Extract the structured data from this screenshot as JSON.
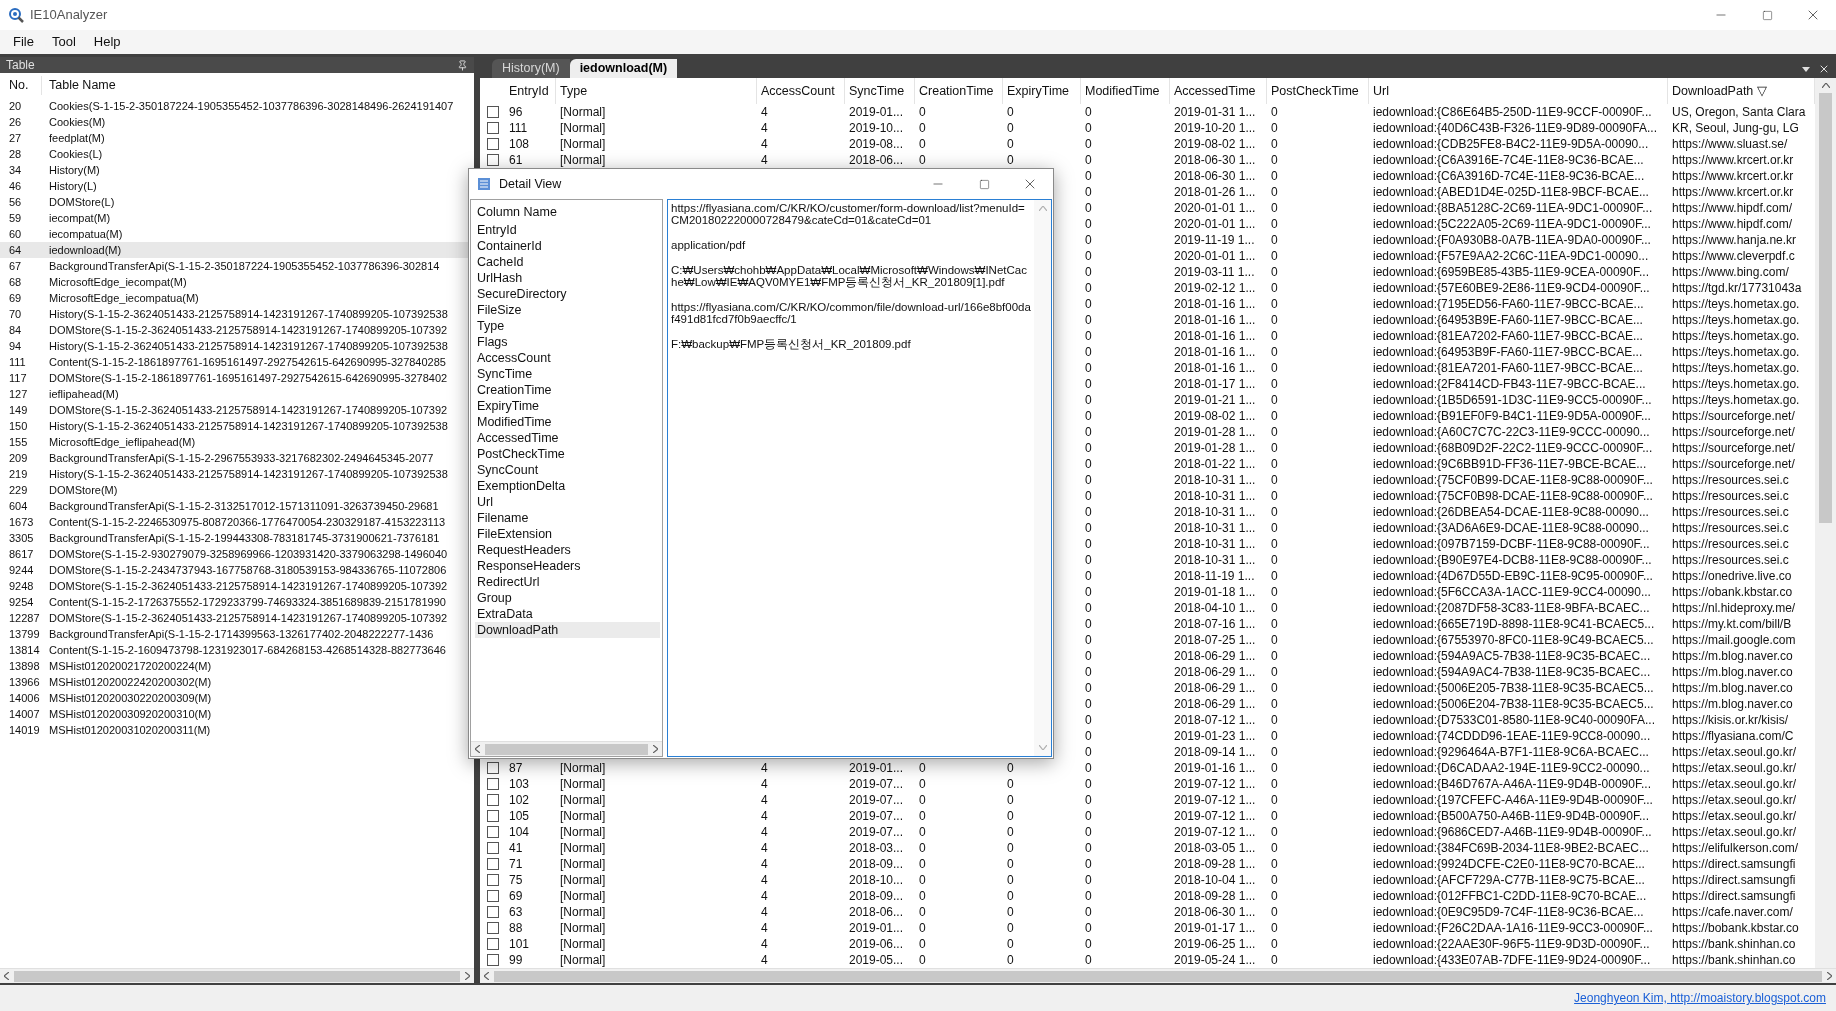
{
  "window": {
    "title": "IE10Analyzer"
  },
  "menu": [
    "File",
    "Tool",
    "Help"
  ],
  "table_panel": {
    "title": "Table",
    "columns": [
      "No.",
      "Table Name"
    ],
    "rows": [
      {
        "no": "20",
        "name": "Cookies(S-1-15-2-350187224-1905355452-1037786396-3028148496-2624191407",
        "selected": false
      },
      {
        "no": "26",
        "name": "Cookies(M)",
        "selected": false
      },
      {
        "no": "27",
        "name": "feedplat(M)",
        "selected": false
      },
      {
        "no": "28",
        "name": "Cookies(L)",
        "selected": false
      },
      {
        "no": "34",
        "name": "History(M)",
        "selected": false
      },
      {
        "no": "46",
        "name": "History(L)",
        "selected": false
      },
      {
        "no": "56",
        "name": "DOMStore(L)",
        "selected": false
      },
      {
        "no": "59",
        "name": "iecompat(M)",
        "selected": false
      },
      {
        "no": "60",
        "name": "iecompatua(M)",
        "selected": false
      },
      {
        "no": "64",
        "name": "iedownload(M)",
        "selected": true
      },
      {
        "no": "67",
        "name": "BackgroundTransferApi(S-1-15-2-350187224-1905355452-1037786396-302814",
        "selected": false
      },
      {
        "no": "68",
        "name": "MicrosoftEdge_iecompat(M)",
        "selected": false
      },
      {
        "no": "69",
        "name": "MicrosoftEdge_iecompatua(M)",
        "selected": false
      },
      {
        "no": "70",
        "name": "History(S-1-15-2-3624051433-2125758914-1423191267-1740899205-107392538",
        "selected": false
      },
      {
        "no": "84",
        "name": "DOMStore(S-1-15-2-3624051433-2125758914-1423191267-1740899205-107392",
        "selected": false
      },
      {
        "no": "94",
        "name": "History(S-1-15-2-3624051433-2125758914-1423191267-1740899205-107392538",
        "selected": false
      },
      {
        "no": "111",
        "name": "Content(S-1-15-2-1861897761-1695161497-2927542615-642690995-327840285",
        "selected": false
      },
      {
        "no": "117",
        "name": "DOMStore(S-1-15-2-1861897761-1695161497-2927542615-642690995-3278402",
        "selected": false
      },
      {
        "no": "127",
        "name": "ieflipahead(M)",
        "selected": false
      },
      {
        "no": "149",
        "name": "DOMStore(S-1-15-2-3624051433-2125758914-1423191267-1740899205-107392",
        "selected": false
      },
      {
        "no": "150",
        "name": "History(S-1-15-2-3624051433-2125758914-1423191267-1740899205-107392538",
        "selected": false
      },
      {
        "no": "155",
        "name": "MicrosoftEdge_ieflipahead(M)",
        "selected": false
      },
      {
        "no": "209",
        "name": "BackgroundTransferApi(S-1-15-2-2967553933-3217682302-2494645345-2077",
        "selected": false
      },
      {
        "no": "219",
        "name": "History(S-1-15-2-3624051433-2125758914-1423191267-1740899205-107392538",
        "selected": false
      },
      {
        "no": "229",
        "name": "DOMStore(M)",
        "selected": false
      },
      {
        "no": "604",
        "name": "BackgroundTransferApi(S-1-15-2-3132517012-1571311091-3263739450-29681",
        "selected": false
      },
      {
        "no": "1673",
        "name": "Content(S-1-15-2-2246530975-808720366-1776470054-230329187-4153223113",
        "selected": false
      },
      {
        "no": "3305",
        "name": "BackgroundTransferApi(S-1-15-2-199443308-783181745-3731900621-7376181",
        "selected": false
      },
      {
        "no": "8617",
        "name": "DOMStore(S-1-15-2-930279079-3258969966-1203931420-3379063298-1496040",
        "selected": false
      },
      {
        "no": "9244",
        "name": "DOMStore(S-1-15-2-2434737943-167758768-3180539153-984336765-11072806",
        "selected": false
      },
      {
        "no": "9248",
        "name": "DOMStore(S-1-15-2-3624051433-2125758914-1423191267-1740899205-107392",
        "selected": false
      },
      {
        "no": "9254",
        "name": "Content(S-1-15-2-1726375552-1729233799-74693324-3851689839-2151781990",
        "selected": false
      },
      {
        "no": "12287",
        "name": "DOMStore(S-1-15-2-3624051433-2125758914-1423191267-1740899205-107392",
        "selected": false
      },
      {
        "no": "13799",
        "name": "BackgroundTransferApi(S-1-15-2-1714399563-1326177402-2048222277-1436",
        "selected": false
      },
      {
        "no": "13814",
        "name": "Content(S-1-15-2-1609473798-1231923017-684268153-4268514328-882773646",
        "selected": false
      },
      {
        "no": "13898",
        "name": "MSHist012020021720200224(M)",
        "selected": false
      },
      {
        "no": "13966",
        "name": "MSHist012020022420200302(M)",
        "selected": false
      },
      {
        "no": "14006",
        "name": "MSHist012020030220200309(M)",
        "selected": false
      },
      {
        "no": "14007",
        "name": "MSHist012020030920200310(M)",
        "selected": false
      },
      {
        "no": "14019",
        "name": "MSHist012020031020200311(M)",
        "selected": false
      }
    ]
  },
  "tabs": [
    {
      "label": "History(M)",
      "selected": false
    },
    {
      "label": "iedownload(M)",
      "selected": true
    }
  ],
  "grid": {
    "columns": [
      "EntryId",
      "Type",
      "AccessCount",
      "SyncTime",
      "CreationTime",
      "ExpiryTime",
      "ModifiedTime",
      "AccessedTime",
      "PostCheckTime",
      "Url",
      "DownloadPath ▽"
    ],
    "rows": [
      {
        "checked": false,
        "entry_id": "96",
        "type": "[Normal]",
        "access_count": "4",
        "sync_time": "2019-01...",
        "creation_time": "0",
        "expiry_time": "0",
        "modified_time": "0",
        "accessed_time": "2019-01-31 1...",
        "post_check_time": "0",
        "url": "iedownload:{C86E64B5-250D-11E9-9CCF-00090F...",
        "download_path": "US, Oregon, Santa Clara"
      },
      {
        "checked": false,
        "entry_id": "111",
        "type": "[Normal]",
        "access_count": "4",
        "sync_time": "2019-10...",
        "creation_time": "0",
        "expiry_time": "0",
        "modified_time": "0",
        "accessed_time": "2019-10-20 1...",
        "post_check_time": "0",
        "url": "iedownload:{40D6C43B-F326-11E9-9D89-00090FA...",
        "download_path": "KR, Seoul, Jung-gu, LG"
      },
      {
        "checked": false,
        "entry_id": "108",
        "type": "[Normal]",
        "access_count": "4",
        "sync_time": "2019-08...",
        "creation_time": "0",
        "expiry_time": "0",
        "modified_time": "0",
        "accessed_time": "2019-08-02 1...",
        "post_check_time": "0",
        "url": "iedownload:{CDB25FE8-B4C2-11E9-9D5A-00090...",
        "download_path": "https://www.sluast.se/"
      },
      {
        "checked": false,
        "entry_id": "61",
        "type": "[Normal]",
        "access_count": "4",
        "sync_time": "2018-06...",
        "creation_time": "0",
        "expiry_time": "0",
        "modified_time": "0",
        "accessed_time": "2018-06-30 1...",
        "post_check_time": "0",
        "url": "iedownload:{C6A3916E-7C4E-11E8-9C36-BCAE...",
        "download_path": "https://www.krcert.or.kr"
      },
      {
        "modified_time": "0",
        "accessed_time": "2018-06-30 1...",
        "post_check_time": "0",
        "url": "iedownload:{C6A3916D-7C4E-11E8-9C36-BCAE...",
        "download_path": "https://www.krcert.or.kr"
      },
      {
        "modified_time": "0",
        "accessed_time": "2018-01-26 1...",
        "post_check_time": "0",
        "url": "iedownload:{ABED1D4E-025D-11E8-9BCF-BCAE...",
        "download_path": "https://www.krcert.or.kr"
      },
      {
        "modified_time": "0",
        "accessed_time": "2020-01-01 1...",
        "post_check_time": "0",
        "url": "iedownload:{8BA5128C-2C69-11EA-9DC1-00090F...",
        "download_path": "https://www.hipdf.com/"
      },
      {
        "modified_time": "0",
        "accessed_time": "2020-01-01 1...",
        "post_check_time": "0",
        "url": "iedownload:{5C222A05-2C69-11EA-9DC1-00090F...",
        "download_path": "https://www.hipdf.com/"
      },
      {
        "modified_time": "0",
        "accessed_time": "2019-11-19 1...",
        "post_check_time": "0",
        "url": "iedownload:{F0A930B8-0A7B-11EA-9DA0-00090F...",
        "download_path": "https://www.hanja.ne.kr"
      },
      {
        "modified_time": "0",
        "accessed_time": "2020-01-01 1...",
        "post_check_time": "0",
        "url": "iedownload:{F57E9AA2-2C6C-11EA-9DC1-00090...",
        "download_path": "https://www.cleverpdf.c"
      },
      {
        "modified_time": "0",
        "accessed_time": "2019-03-11 1...",
        "post_check_time": "0",
        "url": "iedownload:{6959BE85-43B5-11E9-9CEA-00090F...",
        "download_path": "https://www.bing.com/"
      },
      {
        "modified_time": "0",
        "accessed_time": "2019-02-12 1...",
        "post_check_time": "0",
        "url": "iedownload:{57E60BE9-2E86-11E9-9CD4-00090F...",
        "download_path": "https://tgd.kr/17731043a"
      },
      {
        "modified_time": "0",
        "accessed_time": "2018-01-16 1...",
        "post_check_time": "0",
        "url": "iedownload:{7195ED56-FA60-11E7-9BCC-BCAE...",
        "download_path": "https://teys.hometax.go."
      },
      {
        "modified_time": "0",
        "accessed_time": "2018-01-16 1...",
        "post_check_time": "0",
        "url": "iedownload:{64953B9E-FA60-11E7-9BCC-BCAE...",
        "download_path": "https://teys.hometax.go."
      },
      {
        "modified_time": "0",
        "accessed_time": "2018-01-16 1...",
        "post_check_time": "0",
        "url": "iedownload:{81EA7202-FA60-11E7-9BCC-BCAE...",
        "download_path": "https://teys.hometax.go."
      },
      {
        "modified_time": "0",
        "accessed_time": "2018-01-16 1...",
        "post_check_time": "0",
        "url": "iedownload:{64953B9F-FA60-11E7-9BCC-BCAE...",
        "download_path": "https://teys.hometax.go."
      },
      {
        "modified_time": "0",
        "accessed_time": "2018-01-16 1...",
        "post_check_time": "0",
        "url": "iedownload:{81EA7201-FA60-11E7-9BCC-BCAE...",
        "download_path": "https://teys.hometax.go."
      },
      {
        "modified_time": "0",
        "accessed_time": "2018-01-17 1...",
        "post_check_time": "0",
        "url": "iedownload:{2F8414CD-FB43-11E7-9BCC-BCAE...",
        "download_path": "https://teys.hometax.go."
      },
      {
        "modified_time": "0",
        "accessed_time": "2019-01-21 1...",
        "post_check_time": "0",
        "url": "iedownload:{1B5D6591-1D3C-11E9-9CC5-00090F...",
        "download_path": "https://teys.hometax.go."
      },
      {
        "modified_time": "0",
        "accessed_time": "2019-08-02 1...",
        "post_check_time": "0",
        "url": "iedownload:{B91EF0F9-B4C1-11E9-9D5A-00090F...",
        "download_path": "https://sourceforge.net/"
      },
      {
        "modified_time": "0",
        "accessed_time": "2019-01-28 1...",
        "post_check_time": "0",
        "url": "iedownload:{A60C7C7C-22C3-11E9-9CCC-00090...",
        "download_path": "https://sourceforge.net/"
      },
      {
        "modified_time": "0",
        "accessed_time": "2019-01-28 1...",
        "post_check_time": "0",
        "url": "iedownload:{68B09D2F-22C2-11E9-9CCC-00090F...",
        "download_path": "https://sourceforge.net/"
      },
      {
        "modified_time": "0",
        "accessed_time": "2018-01-22 1...",
        "post_check_time": "0",
        "url": "iedownload:{9C6BB91D-FF36-11E7-9BCE-BCAE...",
        "download_path": "https://sourceforge.net/"
      },
      {
        "modified_time": "0",
        "accessed_time": "2018-10-31 1...",
        "post_check_time": "0",
        "url": "iedownload:{75CF0B99-DCAE-11E8-9C88-00090F...",
        "download_path": "https://resources.sei.c"
      },
      {
        "modified_time": "0",
        "accessed_time": "2018-10-31 1...",
        "post_check_time": "0",
        "url": "iedownload:{75CF0B98-DCAE-11E8-9C88-00090F...",
        "download_path": "https://resources.sei.c"
      },
      {
        "modified_time": "0",
        "accessed_time": "2018-10-31 1...",
        "post_check_time": "0",
        "url": "iedownload:{26DBEA54-DCAE-11E8-9C88-00090...",
        "download_path": "https://resources.sei.c"
      },
      {
        "modified_time": "0",
        "accessed_time": "2018-10-31 1...",
        "post_check_time": "0",
        "url": "iedownload:{3AD6A6E9-DCAE-11E8-9C88-00090...",
        "download_path": "https://resources.sei.c"
      },
      {
        "modified_time": "0",
        "accessed_time": "2018-10-31 1...",
        "post_check_time": "0",
        "url": "iedownload:{097B7159-DCBF-11E8-9C88-00090F...",
        "download_path": "https://resources.sei.c"
      },
      {
        "modified_time": "0",
        "accessed_time": "2018-10-31 1...",
        "post_check_time": "0",
        "url": "iedownload:{B90E97E4-DCB8-11E8-9C88-00090F...",
        "download_path": "https://resources.sei.c"
      },
      {
        "modified_time": "0",
        "accessed_time": "2018-11-19 1...",
        "post_check_time": "0",
        "url": "iedownload:{4D67D55D-EB9C-11E8-9C95-00090F...",
        "download_path": "https://onedrive.live.co"
      },
      {
        "modified_time": "0",
        "accessed_time": "2019-01-18 1...",
        "post_check_time": "0",
        "url": "iedownload:{5F6CCA3A-1ACC-11E9-9CC4-00090...",
        "download_path": "https://obank.kbstar.co"
      },
      {
        "modified_time": "0",
        "accessed_time": "2018-04-10 1...",
        "post_check_time": "0",
        "url": "iedownload:{2087DF58-3C83-11E8-9BFA-BCAEC...",
        "download_path": "https://nl.hideproxy.me/"
      },
      {
        "modified_time": "0",
        "accessed_time": "2018-07-16 1...",
        "post_check_time": "0",
        "url": "iedownload:{665E719D-8898-11E8-9C41-BCAEC5...",
        "download_path": "https://my.kt.com/bill/B"
      },
      {
        "modified_time": "0",
        "accessed_time": "2018-07-25 1...",
        "post_check_time": "0",
        "url": "iedownload:{67553970-8FC0-11E8-9C49-BCAEC5...",
        "download_path": "https://mail.google.com"
      },
      {
        "modified_time": "0",
        "accessed_time": "2018-06-29 1...",
        "post_check_time": "0",
        "url": "iedownload:{594A9AC5-7B38-11E8-9C35-BCAEC...",
        "download_path": "https://m.blog.naver.co"
      },
      {
        "modified_time": "0",
        "accessed_time": "2018-06-29 1...",
        "post_check_time": "0",
        "url": "iedownload:{594A9AC4-7B38-11E8-9C35-BCAEC...",
        "download_path": "https://m.blog.naver.co"
      },
      {
        "modified_time": "0",
        "accessed_time": "2018-06-29 1...",
        "post_check_time": "0",
        "url": "iedownload:{5006E205-7B38-11E8-9C35-BCAEC5...",
        "download_path": "https://m.blog.naver.co"
      },
      {
        "modified_time": "0",
        "accessed_time": "2018-06-29 1...",
        "post_check_time": "0",
        "url": "iedownload:{5006E204-7B38-11E8-9C35-BCAEC5...",
        "download_path": "https://m.blog.naver.co"
      },
      {
        "modified_time": "0",
        "accessed_time": "2018-07-12 1...",
        "post_check_time": "0",
        "url": "iedownload:{D7533C01-8580-11E8-9C40-00090FA...",
        "download_path": "https://kisis.or.kr/kisis/"
      },
      {
        "modified_time": "0",
        "accessed_time": "2019-01-23 1...",
        "post_check_time": "0",
        "url": "iedownload:{74CDDD96-1EAE-11E9-9CC8-00090...",
        "download_path": "https://flyasiana.com/C"
      },
      {
        "modified_time": "0",
        "accessed_time": "2018-09-14 1...",
        "post_check_time": "0",
        "url": "iedownload:{9296464A-B7F1-11E8-9C6A-BCAEC...",
        "download_path": "https://etax.seoul.go.kr/"
      },
      {
        "checked": false,
        "entry_id": "87",
        "type": "[Normal]",
        "access_count": "4",
        "sync_time": "2019-01...",
        "creation_time": "0",
        "expiry_time": "0",
        "modified_time": "0",
        "accessed_time": "2019-01-16 1...",
        "post_check_time": "0",
        "url": "iedownload:{D6CADAA2-194E-11E9-9CC2-00090...",
        "download_path": "https://etax.seoul.go.kr/"
      },
      {
        "checked": false,
        "entry_id": "103",
        "type": "[Normal]",
        "access_count": "4",
        "sync_time": "2019-07...",
        "creation_time": "0",
        "expiry_time": "0",
        "modified_time": "0",
        "accessed_time": "2019-07-12 1...",
        "post_check_time": "0",
        "url": "iedownload:{B46D767A-A46A-11E9-9D4B-00090F...",
        "download_path": "https://etax.seoul.go.kr/"
      },
      {
        "checked": false,
        "entry_id": "102",
        "type": "[Normal]",
        "access_count": "4",
        "sync_time": "2019-07...",
        "creation_time": "0",
        "expiry_time": "0",
        "modified_time": "0",
        "accessed_time": "2019-07-12 1...",
        "post_check_time": "0",
        "url": "iedownload:{197CFEFC-A46A-11E9-9D4B-00090F...",
        "download_path": "https://etax.seoul.go.kr/"
      },
      {
        "checked": false,
        "entry_id": "105",
        "type": "[Normal]",
        "access_count": "4",
        "sync_time": "2019-07...",
        "creation_time": "0",
        "expiry_time": "0",
        "modified_time": "0",
        "accessed_time": "2019-07-12 1...",
        "post_check_time": "0",
        "url": "iedownload:{B500A750-A46B-11E9-9D4B-00090F...",
        "download_path": "https://etax.seoul.go.kr/"
      },
      {
        "checked": false,
        "entry_id": "104",
        "type": "[Normal]",
        "access_count": "4",
        "sync_time": "2019-07...",
        "creation_time": "0",
        "expiry_time": "0",
        "modified_time": "0",
        "accessed_time": "2019-07-12 1...",
        "post_check_time": "0",
        "url": "iedownload:{9686CED7-A46B-11E9-9D4B-00090F...",
        "download_path": "https://etax.seoul.go.kr/"
      },
      {
        "checked": false,
        "entry_id": "41",
        "type": "[Normal]",
        "access_count": "4",
        "sync_time": "2018-03...",
        "creation_time": "0",
        "expiry_time": "0",
        "modified_time": "0",
        "accessed_time": "2018-03-05 1...",
        "post_check_time": "0",
        "url": "iedownload:{384FC69B-2034-11E8-9BE2-BCAEC...",
        "download_path": "https://elifulkerson.com/"
      },
      {
        "checked": false,
        "entry_id": "71",
        "type": "[Normal]",
        "access_count": "4",
        "sync_time": "2018-09...",
        "creation_time": "0",
        "expiry_time": "0",
        "modified_time": "0",
        "accessed_time": "2018-09-28 1...",
        "post_check_time": "0",
        "url": "iedownload:{9924DCFE-C2E0-11E8-9C70-BCAE...",
        "download_path": "https://direct.samsungfi"
      },
      {
        "checked": false,
        "entry_id": "75",
        "type": "[Normal]",
        "access_count": "4",
        "sync_time": "2018-10...",
        "creation_time": "0",
        "expiry_time": "0",
        "modified_time": "0",
        "accessed_time": "2018-10-04 1...",
        "post_check_time": "0",
        "url": "iedownload:{AFCF729A-C77B-11E8-9C75-BCAE...",
        "download_path": "https://direct.samsungfi"
      },
      {
        "checked": false,
        "entry_id": "69",
        "type": "[Normal]",
        "access_count": "4",
        "sync_time": "2018-09...",
        "creation_time": "0",
        "expiry_time": "0",
        "modified_time": "0",
        "accessed_time": "2018-09-28 1...",
        "post_check_time": "0",
        "url": "iedownload:{012FFBC1-C2DD-11E8-9C70-BCAE...",
        "download_path": "https://direct.samsungfi"
      },
      {
        "checked": false,
        "entry_id": "63",
        "type": "[Normal]",
        "access_count": "4",
        "sync_time": "2018-06...",
        "creation_time": "0",
        "expiry_time": "0",
        "modified_time": "0",
        "accessed_time": "2018-06-30 1...",
        "post_check_time": "0",
        "url": "iedownload:{0E9C95D9-7C4F-11E8-9C36-BCAE...",
        "download_path": "https://cafe.naver.com/"
      },
      {
        "checked": false,
        "entry_id": "88",
        "type": "[Normal]",
        "access_count": "4",
        "sync_time": "2019-01...",
        "creation_time": "0",
        "expiry_time": "0",
        "modified_time": "0",
        "accessed_time": "2019-01-17 1...",
        "post_check_time": "0",
        "url": "iedownload:{F26C2DAA-1A16-11E9-9CC3-00090F...",
        "download_path": "https://bobank.kbstar.co"
      },
      {
        "checked": false,
        "entry_id": "101",
        "type": "[Normal]",
        "access_count": "4",
        "sync_time": "2019-06...",
        "creation_time": "0",
        "expiry_time": "0",
        "modified_time": "0",
        "accessed_time": "2019-06-25 1...",
        "post_check_time": "0",
        "url": "iedownload:{22AAE30F-96F5-11E9-9D3D-00090F...",
        "download_path": "https://bank.shinhan.co"
      },
      {
        "checked": false,
        "entry_id": "99",
        "type": "[Normal]",
        "access_count": "4",
        "sync_time": "2019-05...",
        "creation_time": "0",
        "expiry_time": "0",
        "modified_time": "0",
        "accessed_time": "2019-05-24 1...",
        "post_check_time": "0",
        "url": "iedownload:{433E07AB-7DFE-11E9-9D24-00090F...",
        "download_path": "https://bank.shinhan.co"
      }
    ]
  },
  "detail_view": {
    "title": "Detail View",
    "list_header": "Column Name",
    "fields": [
      {
        "label": "EntryId",
        "selected": false
      },
      {
        "label": "ContainerId",
        "selected": false
      },
      {
        "label": "CacheId",
        "selected": false
      },
      {
        "label": "UrlHash",
        "selected": false
      },
      {
        "label": "SecureDirectory",
        "selected": false
      },
      {
        "label": "FileSize",
        "selected": false
      },
      {
        "label": "Type",
        "selected": false
      },
      {
        "label": "Flags",
        "selected": false
      },
      {
        "label": "AccessCount",
        "selected": false
      },
      {
        "label": "SyncTime",
        "selected": false
      },
      {
        "label": "CreationTime",
        "selected": false
      },
      {
        "label": "ExpiryTime",
        "selected": false
      },
      {
        "label": "ModifiedTime",
        "selected": false
      },
      {
        "label": "AccessedTime",
        "selected": false
      },
      {
        "label": "PostCheckTime",
        "selected": false
      },
      {
        "label": "SyncCount",
        "selected": false
      },
      {
        "label": "ExemptionDelta",
        "selected": false
      },
      {
        "label": "Url",
        "selected": false
      },
      {
        "label": "Filename",
        "selected": false
      },
      {
        "label": "FileExtension",
        "selected": false
      },
      {
        "label": "RequestHeaders",
        "selected": false
      },
      {
        "label": "ResponseHeaders",
        "selected": false
      },
      {
        "label": "RedirectUrl",
        "selected": false
      },
      {
        "label": "Group",
        "selected": false
      },
      {
        "label": "ExtraData",
        "selected": false
      },
      {
        "label": "DownloadPath",
        "selected": true
      }
    ],
    "value": [
      "https://flyasiana.com/C/KR/KO/customer/form-download/list?menuId=CM201802220000728479&cateCd=01&cateCd=01",
      "application/pdf",
      "C:₩Users₩chohb₩AppData₩Local₩Microsoft₩Windows₩INetCache₩Low₩IE₩AQV0MYE1₩FMP등록신청서_KR_201809[1].pdf",
      "https://flyasiana.com/C/KR/KO/common/file/download-url/166e8bf00daf491d81fcd7f0b9aecffc/1",
      "F:₩backup₩FMP등록신청서_KR_201809.pdf"
    ]
  },
  "status_bar": {
    "link": "Jeonghyeon Kim, http://moaistory.blogspot.com"
  }
}
